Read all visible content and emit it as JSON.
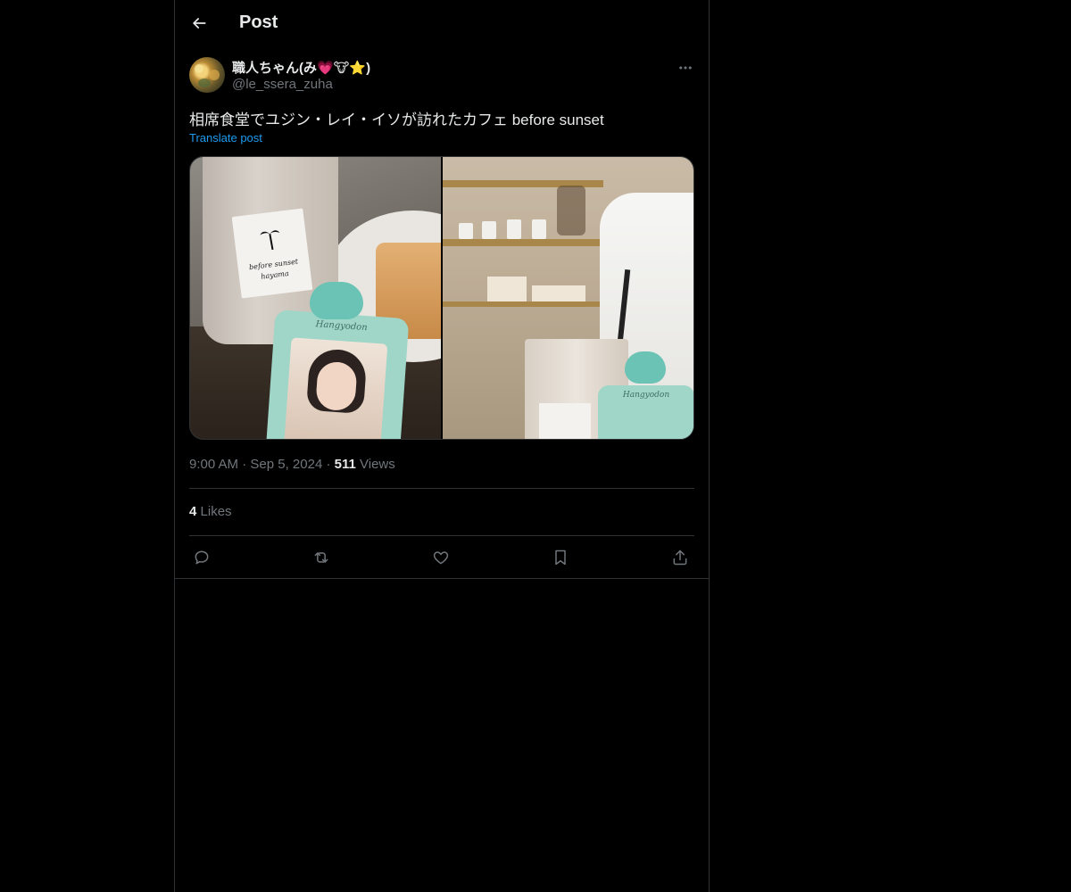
{
  "header": {
    "back_icon": "arrow-left-icon",
    "title": "Post"
  },
  "author": {
    "display_name": "職人ちゃん(み💗🐮⭐)",
    "handle": "@le_ssera_zuha"
  },
  "post": {
    "text": "相席食堂でユジン・レイ・イソが訪れたカフェ before sunset",
    "translate_label": "Translate post",
    "media": [
      {
        "cup_label_line1": "before sunset",
        "cup_label_line2": "hayama",
        "keychain_label": "Hangyodon"
      },
      {
        "keychain_label": "Hangyodon"
      }
    ],
    "time": "9:00 AM",
    "date": "Sep 5, 2024",
    "views_count": "511",
    "views_label": "Views",
    "likes_count": "4",
    "likes_label": "Likes"
  },
  "actions": [
    {
      "name": "reply",
      "icon": "reply-icon"
    },
    {
      "name": "repost",
      "icon": "repost-icon"
    },
    {
      "name": "like",
      "icon": "heart-icon"
    },
    {
      "name": "bookmark",
      "icon": "bookmark-icon"
    },
    {
      "name": "share",
      "icon": "share-icon"
    }
  ],
  "colors": {
    "background": "#000000",
    "text_primary": "#e7e9ea",
    "text_secondary": "#71767b",
    "link": "#1d9bf0",
    "border": "#2f3336"
  }
}
